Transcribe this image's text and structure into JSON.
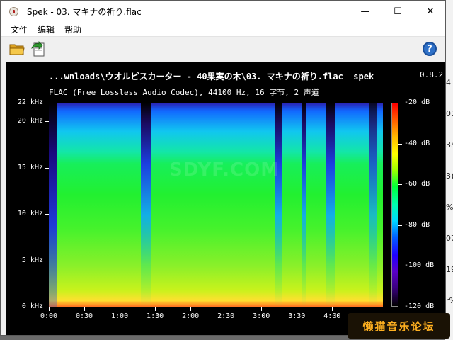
{
  "window": {
    "title": "Spek - 03. マキナの祈り.flac",
    "minimize_glyph": "—",
    "maximize_glyph": "☐",
    "close_glyph": "✕"
  },
  "menu": [
    {
      "label": "文件"
    },
    {
      "label": "编辑"
    },
    {
      "label": "帮助"
    }
  ],
  "toolbar": {
    "open_icon": "folder-open-icon",
    "save_icon": "save-export-icon",
    "help_icon": "help-icon",
    "help_glyph": "?"
  },
  "spectrogram": {
    "file_path": "...wnloads\\ウオルピスカーター - 40果実の木\\03. マキナの祈り.flac",
    "app_name": "spek",
    "version": "0.8.2",
    "info": "FLAC (Free Lossless Audio Codec), 44100 Hz, 16 字节, 2 声道",
    "y_ticks": [
      {
        "label": "22 kHz",
        "value": 22
      },
      {
        "label": "20 kHz",
        "value": 20
      },
      {
        "label": "15 kHz",
        "value": 15
      },
      {
        "label": "10 kHz",
        "value": 10
      },
      {
        "label": "5 kHz",
        "value": 5
      },
      {
        "label": "0 kHz",
        "value": 0
      }
    ],
    "y_range": [
      0,
      22
    ],
    "x_ticks": [
      {
        "label": "0:00",
        "seconds": 0
      },
      {
        "label": "0:30",
        "seconds": 30
      },
      {
        "label": "1:00",
        "seconds": 60
      },
      {
        "label": "1:30",
        "seconds": 90
      },
      {
        "label": "2:00",
        "seconds": 120
      },
      {
        "label": "2:30",
        "seconds": 150
      },
      {
        "label": "3:00",
        "seconds": 180
      },
      {
        "label": "3:30",
        "seconds": 210
      },
      {
        "label": "4:00",
        "seconds": 240
      }
    ],
    "x_range_seconds": [
      0,
      283
    ],
    "db_ticks": [
      {
        "label": "-20 dB",
        "value": -20
      },
      {
        "label": "-40 dB",
        "value": -40
      },
      {
        "label": "-60 dB",
        "value": -60
      },
      {
        "label": "-80 dB",
        "value": -80
      },
      {
        "label": "-100 dB",
        "value": -100
      },
      {
        "label": "-120 dB",
        "value": -120
      }
    ],
    "db_range": [
      -120,
      -20
    ],
    "watermark": "SDYF.COM"
  },
  "background_right_chars": [
    "4",
    "01",
    "35",
    "3)",
    "%",
    "07",
    "19",
    "r%"
  ],
  "site_badge": "懒猫音乐论坛"
}
